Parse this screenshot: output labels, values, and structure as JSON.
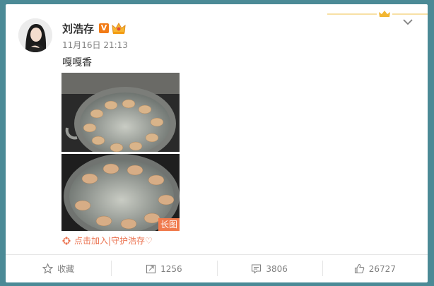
{
  "post": {
    "author": "刘浩存",
    "verified_badge": "V",
    "timestamp": "11月16日 21:13",
    "text": "嘎嘎香",
    "long_image_tag": "长图",
    "topic": "点击加入|守护浩存♡"
  },
  "actions": {
    "favorite_label": "收藏",
    "repost_count": "1256",
    "comment_count": "3806",
    "like_count": "26727"
  },
  "colors": {
    "accent": "#eb7350",
    "verified": "#f27b16",
    "page_bg": "#4b8a96"
  },
  "icons": [
    "crown-icon",
    "chevron-down-icon",
    "topic-icon",
    "star-icon",
    "repost-icon",
    "comment-icon",
    "like-icon"
  ]
}
